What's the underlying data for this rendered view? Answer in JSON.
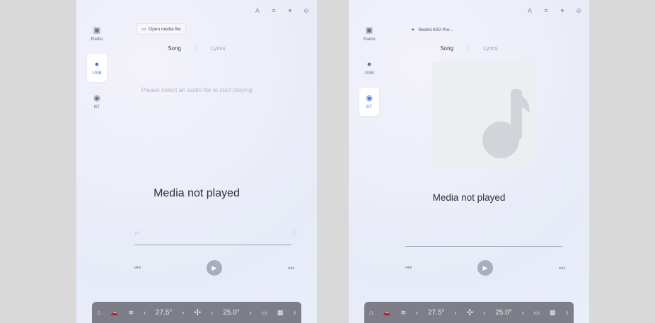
{
  "screens": [
    {
      "status_icons": [
        "A",
        "≡",
        "✦",
        "⊘"
      ],
      "sidebar": [
        {
          "icon": "📻",
          "label": "Radio"
        },
        {
          "icon": "🖱",
          "label": "USB"
        },
        {
          "icon": "Ƀ",
          "label": "BT"
        }
      ],
      "open_media_file": "Open media file",
      "tabs": {
        "song": "Song",
        "lyrics": "Lyrics"
      },
      "placeholder": "Please select an audio file to start playing",
      "title": "Media not played",
      "dock": {
        "temp_left": "27.5°",
        "temp_right": "25.0°"
      }
    },
    {
      "status_icons": [
        "A",
        "≡",
        "✦",
        "⊘"
      ],
      "sidebar": [
        {
          "icon": "📻",
          "label": "Radio"
        },
        {
          "icon": "🖱",
          "label": "USB"
        },
        {
          "icon": "Ƀ",
          "label": "BT"
        }
      ],
      "device_name": "Redmi K50 Pro...",
      "tabs": {
        "song": "Song",
        "lyrics": "Lyrics"
      },
      "title": "Media not played",
      "dock": {
        "temp_left": "27.5°",
        "temp_right": "25.0°"
      }
    }
  ],
  "colors": {
    "accent": "#4a78e0",
    "dock": "#7d7e87"
  }
}
